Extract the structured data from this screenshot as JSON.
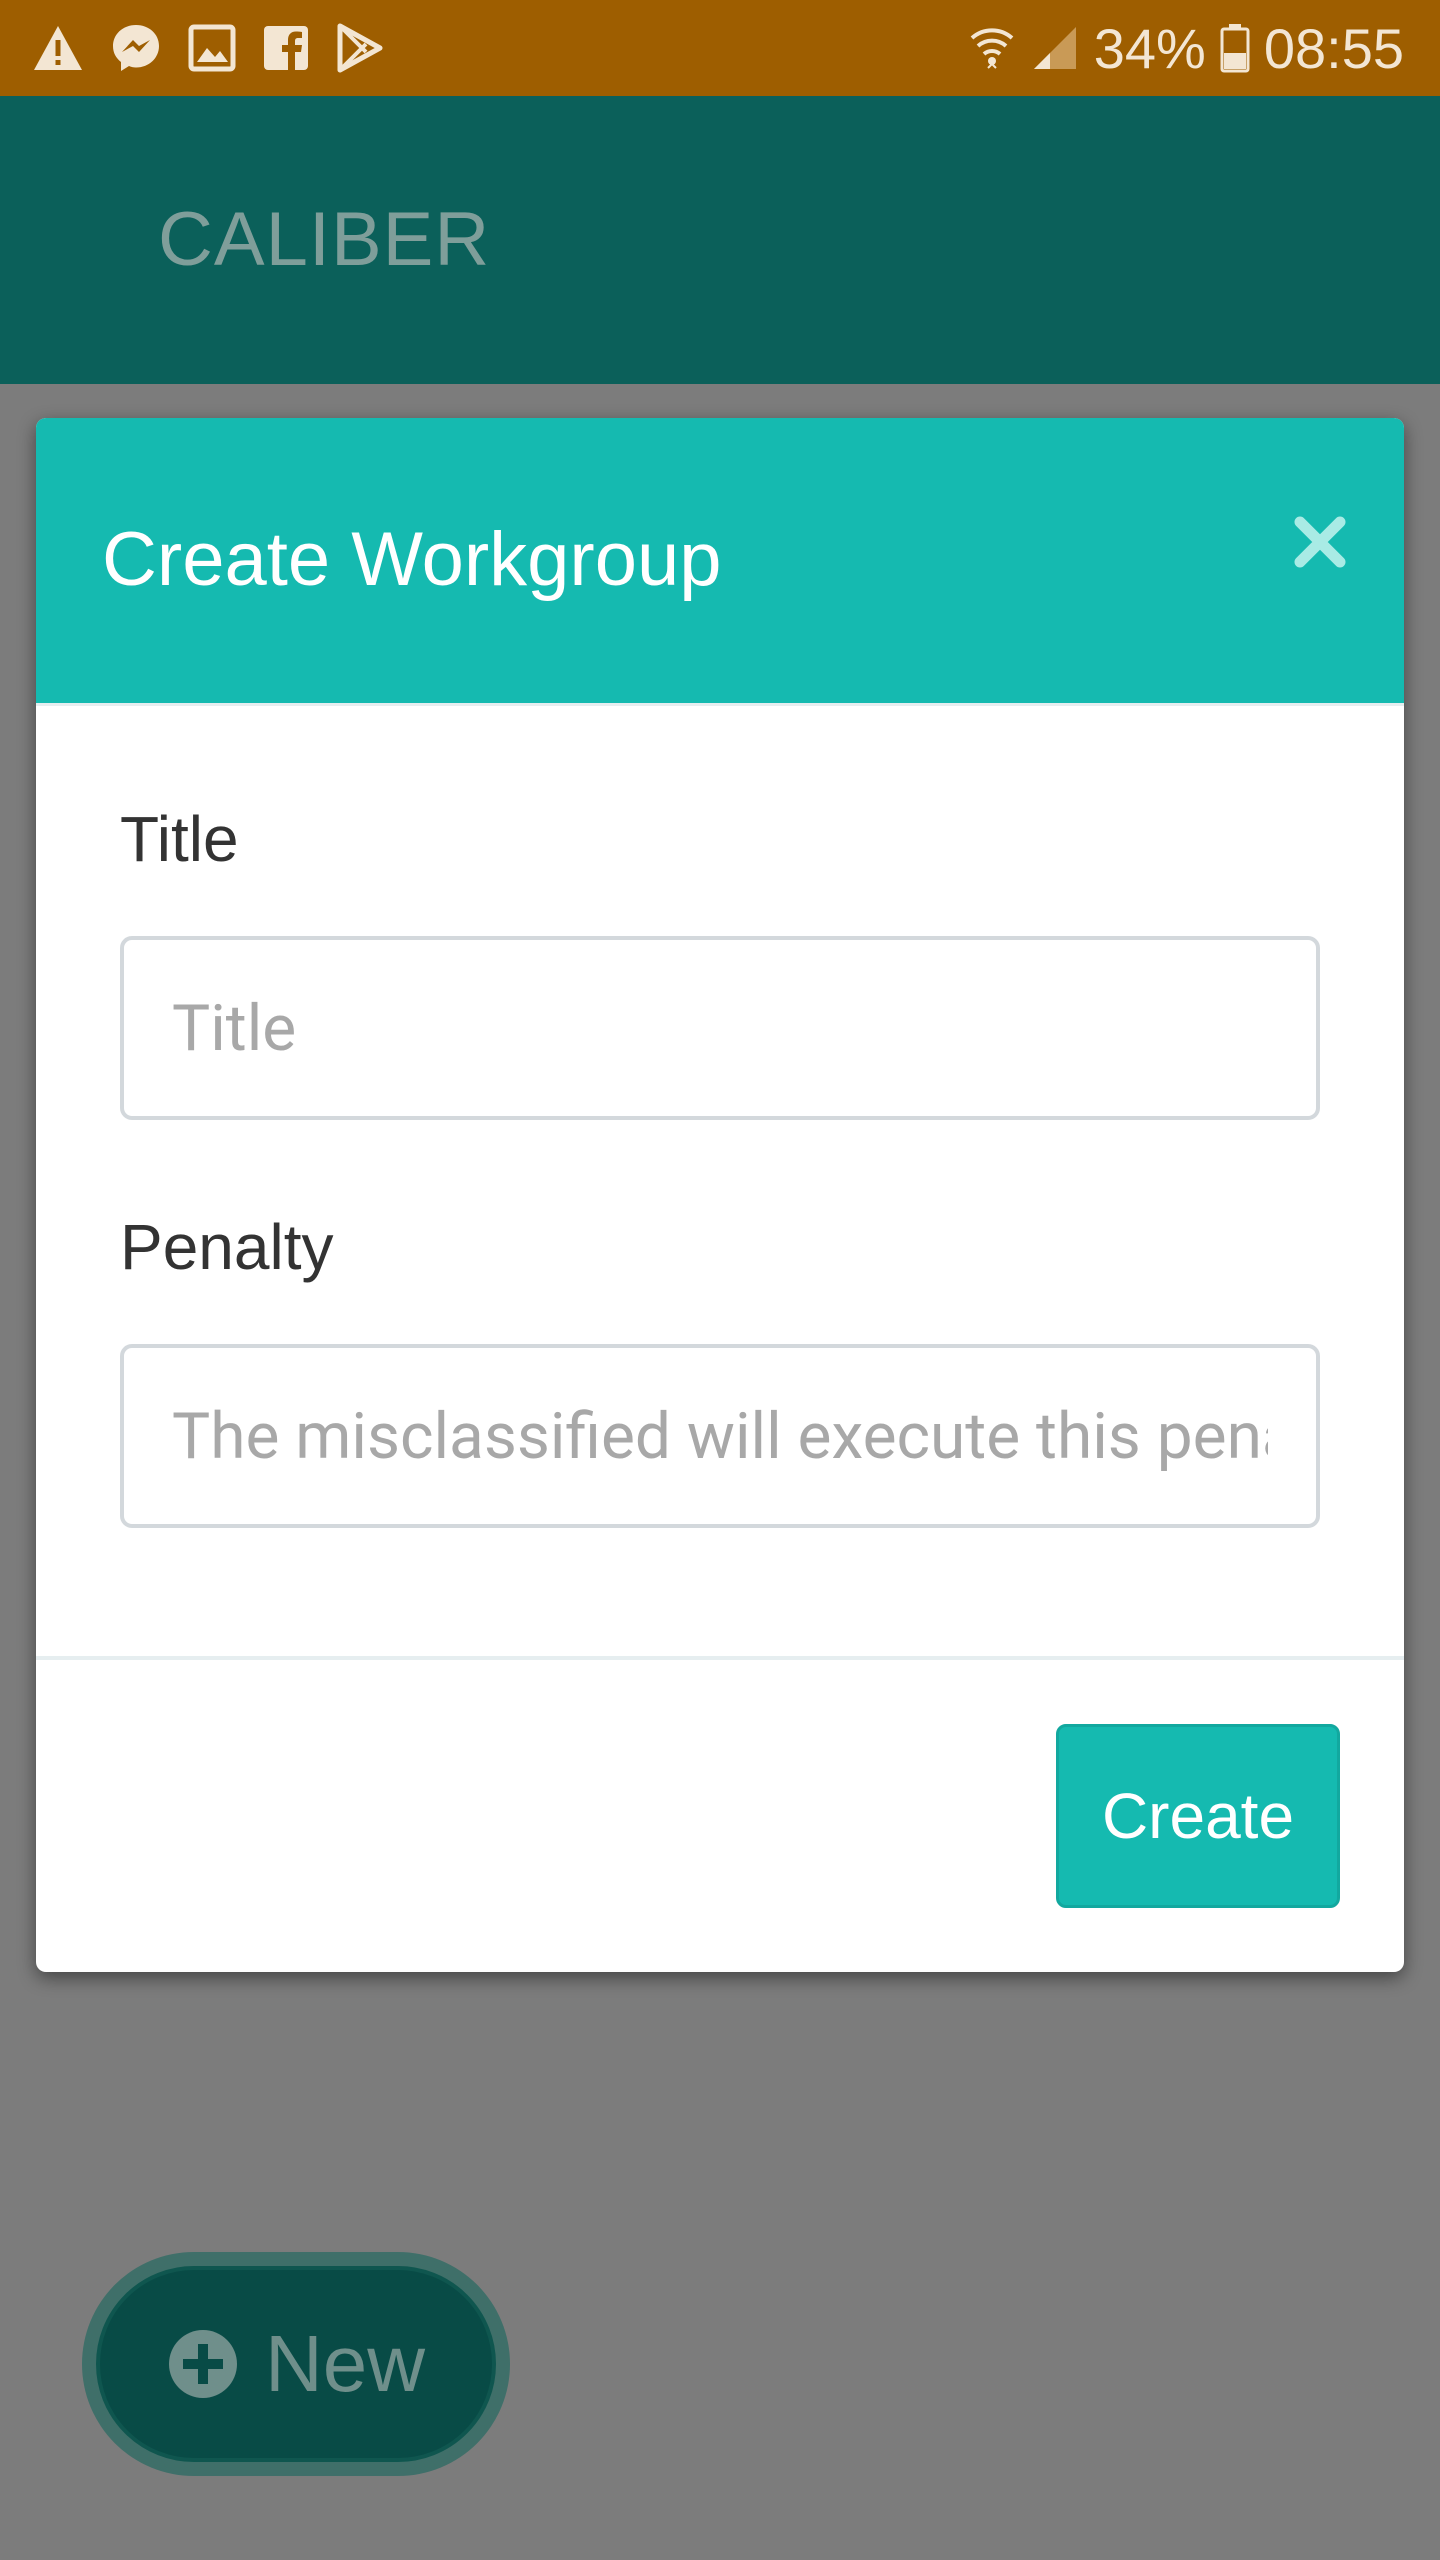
{
  "status_bar": {
    "left_icons": [
      "warning-icon",
      "messenger-icon",
      "image-icon",
      "facebook-icon",
      "play-store-icon"
    ],
    "battery_percent": "34%",
    "time": "08:55"
  },
  "app_bar": {
    "title": "CALIBER"
  },
  "modal": {
    "title": "Create Workgroup",
    "fields": [
      {
        "label": "Title",
        "placeholder": "Title",
        "value": ""
      },
      {
        "label": "Penalty",
        "placeholder": "The misclassified will execute this penalty",
        "value": ""
      }
    ],
    "submit_label": "Create"
  },
  "fab": {
    "label": "New",
    "icon": "plus-circle-icon"
  },
  "colors": {
    "status_bar": "#9e5e00",
    "app_bar": "#0b605a",
    "accent": "#15bab0",
    "overlay": "#7c7c7c"
  }
}
